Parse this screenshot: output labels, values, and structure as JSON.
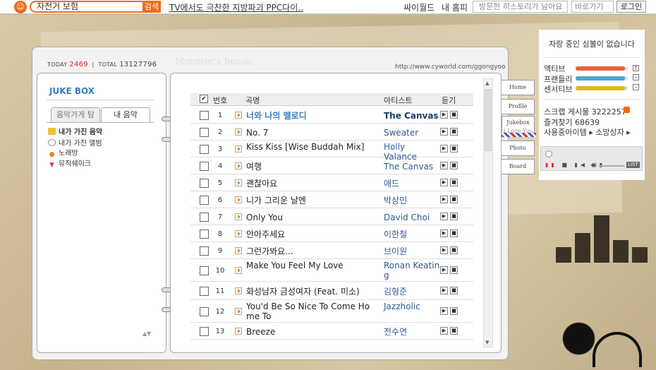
{
  "topbar": {
    "logo": "☺",
    "search_value": "자전거 보험",
    "search_button": "검색",
    "ad_link": "TV에서도 극찬한 지방파괴 PPC다이..",
    "cyworld": "싸이월드",
    "my_home": "내 홈피",
    "history": "방문한 히스토리가 남아요",
    "shortcut": "바로가기",
    "login": "로그인"
  },
  "home": {
    "today_label": "TODAY",
    "today_count": "2469",
    "total_label": "TOTAL",
    "total_count": "13127796",
    "title": "Monster's house",
    "url": "http://www.cyworld.com/ggongyoo"
  },
  "left": {
    "title": "JUKE BOX",
    "tabs": [
      "음악가게 탐",
      "내 음악"
    ],
    "menu": [
      "내가 가진 음악",
      "내가 가진 앨범",
      "노래방",
      "뮤직쉐이크"
    ]
  },
  "table": {
    "headers": {
      "title": "곡명",
      "artist": "아티스트",
      "listen": "듣기",
      "number": "번호"
    },
    "rows": [
      {
        "num": "1",
        "title": "너와 나의 멜로디",
        "artist": "The Canvas",
        "highlight": true
      },
      {
        "num": "2",
        "title": "No. 7",
        "artist": "Sweater"
      },
      {
        "num": "3",
        "title": "Kiss Kiss [Wise Buddah Mix]",
        "artist": "Holly Valance"
      },
      {
        "num": "4",
        "title": "여행",
        "artist": "The Canvas"
      },
      {
        "num": "5",
        "title": "괜찮아요",
        "artist": "애드"
      },
      {
        "num": "6",
        "title": "니가 그리운 날엔",
        "artist": "박상민"
      },
      {
        "num": "7",
        "title": "Only You",
        "artist": "David Choi"
      },
      {
        "num": "8",
        "title": "안아주세요",
        "artist": "이한철"
      },
      {
        "num": "9",
        "title": "그런가봐요...",
        "artist": "브이원"
      },
      {
        "num": "10",
        "title": "Make You Feel My Love",
        "artist": "Ronan Keatin g"
      },
      {
        "num": "11",
        "title": "화성남자 금성여자 (Feat. 미소)",
        "artist": "김형준"
      },
      {
        "num": "12",
        "title": "You'd Be So Nice To Come Ho me To",
        "artist": "Jazzholic"
      },
      {
        "num": "13",
        "title": "Breeze",
        "artist": "전수연"
      }
    ]
  },
  "sidetabs": [
    "Home",
    "Profile",
    "Jukebox",
    "Photo",
    "Board"
  ],
  "jukebox_note": "I Love You",
  "right": {
    "mood": "자랑 중인 심볼이 없습니다",
    "stats": [
      {
        "label": "액티브",
        "color": "#e2623a",
        "fill": 0.95,
        "sign": "↑"
      },
      {
        "label": "프랜들리",
        "color": "#4aa8c8",
        "fill": 0.95,
        "sign": "–"
      },
      {
        "label": "센서티브",
        "color": "#e0b81c",
        "fill": 0.95,
        "sign": "–"
      }
    ],
    "scrap": "스크랩 게시물 3222257",
    "favorites": "즐겨찾기 68639",
    "items": "사용중아이템 ▸ 소망상자 ▸",
    "player": {
      "ctrls": "■ ▮◀ ▶▮",
      "pause": "▮▮",
      "vol": "◀)",
      "list": "LIST"
    }
  }
}
